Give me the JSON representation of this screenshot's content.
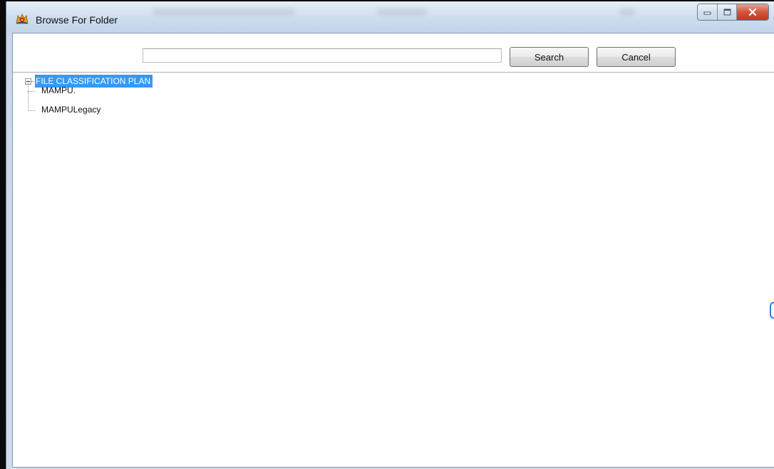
{
  "window": {
    "title": "Browse For Folder",
    "icon": "malaysia-crest-icon",
    "controls": {
      "minimize": "minimize-icon",
      "maximize": "maximize-icon",
      "close": "close-icon"
    },
    "accent_close": "#c23a22"
  },
  "toolbar": {
    "search_value": "",
    "search_placeholder": "",
    "search_label": "Search",
    "cancel_label": "Cancel"
  },
  "tree": {
    "root": {
      "label": "FILE CLASSIFICATION PLAN",
      "expanded": true,
      "selected": true,
      "selection_color": "#3399ff",
      "children": [
        {
          "label": "MAMPU."
        },
        {
          "label": "MAMPULegacy"
        }
      ]
    }
  }
}
